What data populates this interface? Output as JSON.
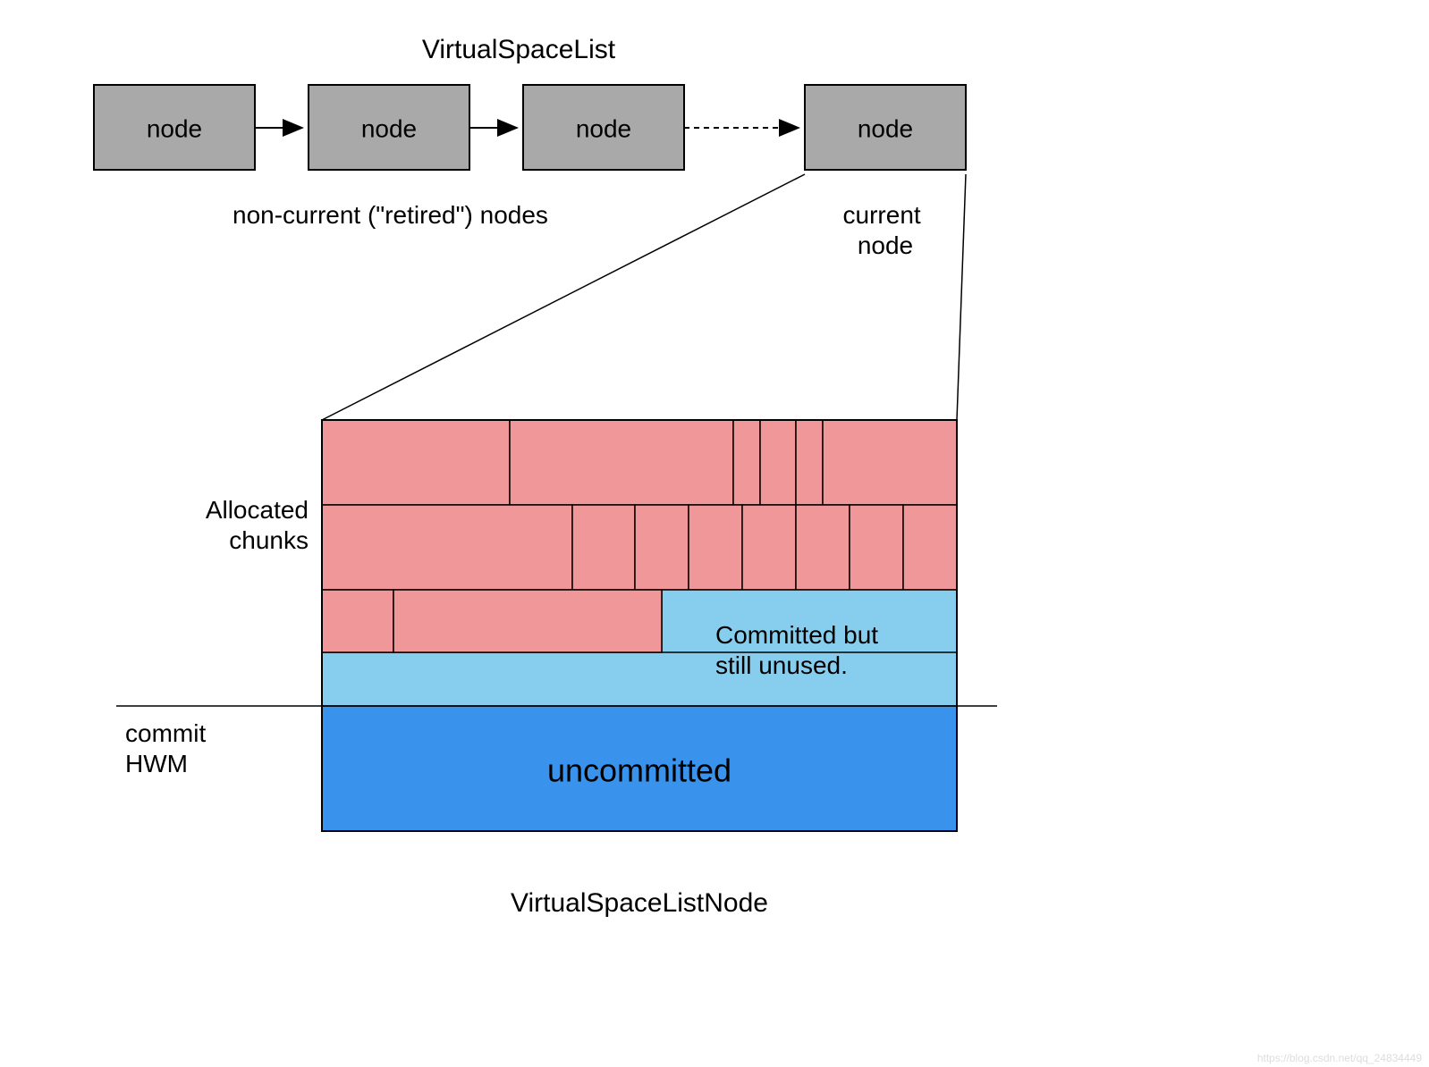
{
  "title": "VirtualSpaceList",
  "nodes": {
    "label": "node",
    "retired_caption": "non-current (\"retired\") nodes",
    "current_caption": "current\nnode"
  },
  "detail": {
    "allocated_label": "Allocated\nchunks",
    "committed_label": "Committed but\nstill unused.",
    "uncommitted_label": "uncommitted",
    "hwm_label": "commit\nHWM",
    "bottom_title": "VirtualSpaceListNode"
  },
  "colors": {
    "node": "#a9a9a9",
    "chunk": "#f0979a",
    "committed_unused": "#87ceee",
    "uncommitted": "#3992ec"
  },
  "chart_data": {
    "type": "diagram",
    "description": "Linked list of VirtualSpaceList nodes with detailed breakdown of current node memory layout",
    "node_list": {
      "retired_count": 3,
      "current_count": 1,
      "link_style_last": "dashed"
    },
    "memory_layout": {
      "rows": [
        {
          "type": "allocated",
          "chunks": [
            210,
            250,
            30,
            40,
            30,
            150
          ]
        },
        {
          "type": "allocated",
          "chunks": [
            280,
            70,
            60,
            60,
            60,
            60,
            60,
            60
          ]
        },
        {
          "type": "mixed",
          "allocated_chunks": [
            80,
            300
          ],
          "committed_unused_width": 330
        },
        {
          "type": "committed_unused_full"
        },
        {
          "type": "uncommitted"
        }
      ],
      "hwm_between_rows": [
        3,
        4
      ]
    }
  },
  "watermark": "https://blog.csdn.net/qq_24834449"
}
